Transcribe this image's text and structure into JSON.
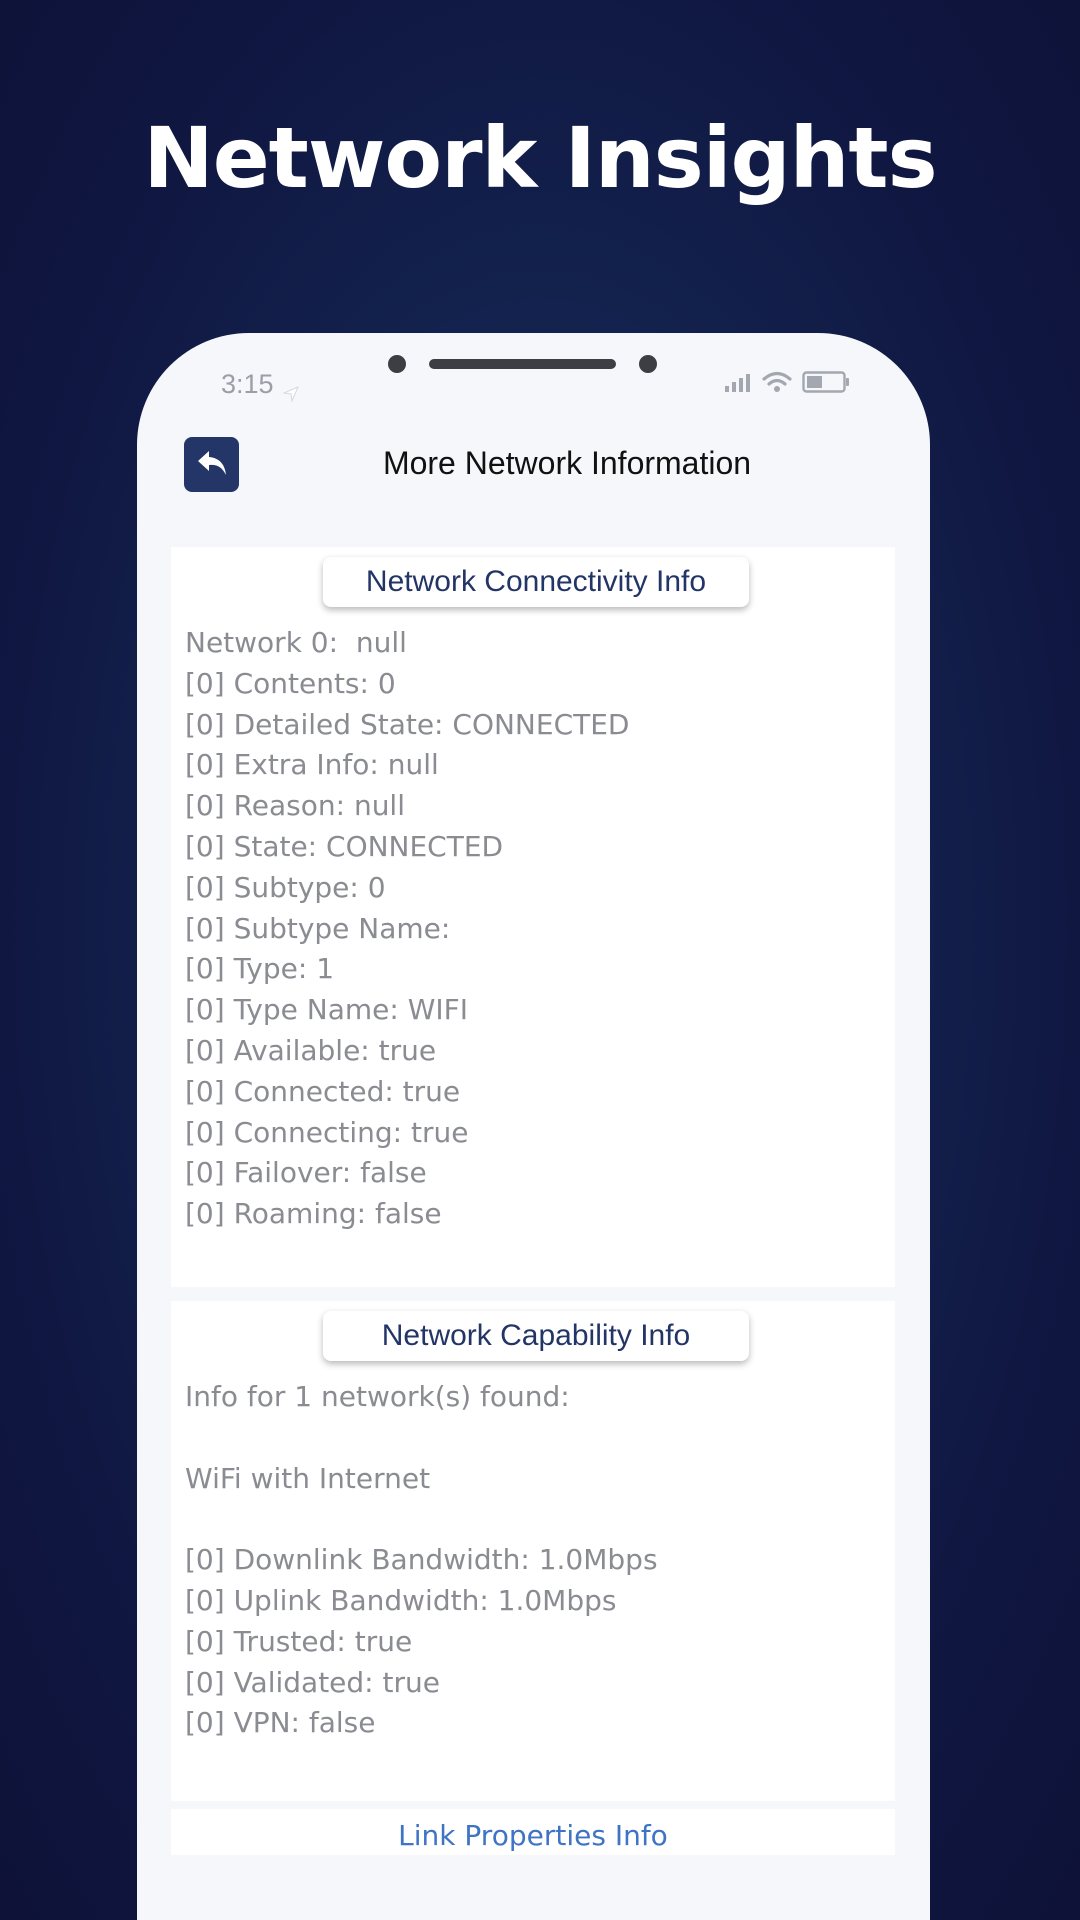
{
  "headline": "Network Insights",
  "status_bar": {
    "time": "3:15"
  },
  "header": {
    "title": "More Network Information"
  },
  "connectivity": {
    "title": "Network Connectivity Info",
    "lines": [
      "Network 0:  null",
      "[0] Contents: 0",
      "[0] Detailed State: CONNECTED",
      "[0] Extra Info: null",
      "[0] Reason: null",
      "[0] State: CONNECTED",
      "[0] Subtype: 0",
      "[0] Subtype Name:",
      "[0] Type: 1",
      "[0] Type Name: WIFI",
      "[0] Available: true",
      "[0] Connected: true",
      "[0] Connecting: true",
      "[0] Failover: false",
      "[0] Roaming: false"
    ]
  },
  "capability": {
    "title": "Network Capability Info",
    "lines": [
      "Info for 1 network(s) found:",
      "",
      "WiFi with Internet",
      "",
      "[0] Downlink Bandwidth: 1.0Mbps",
      "[0] Uplink Bandwidth: 1.0Mbps",
      "[0] Trusted: true",
      "[0] Validated: true",
      "[0] VPN: false"
    ]
  },
  "link_properties": {
    "title": "Link Properties Info"
  },
  "colors": {
    "accent": "#243568",
    "card_title": "#233566",
    "body_text": "#8a8c92",
    "link_text": "#3f74c4"
  },
  "icons": [
    "back-arrow-icon",
    "location-arrow-icon",
    "signal-icon",
    "wifi-icon",
    "battery-icon"
  ]
}
